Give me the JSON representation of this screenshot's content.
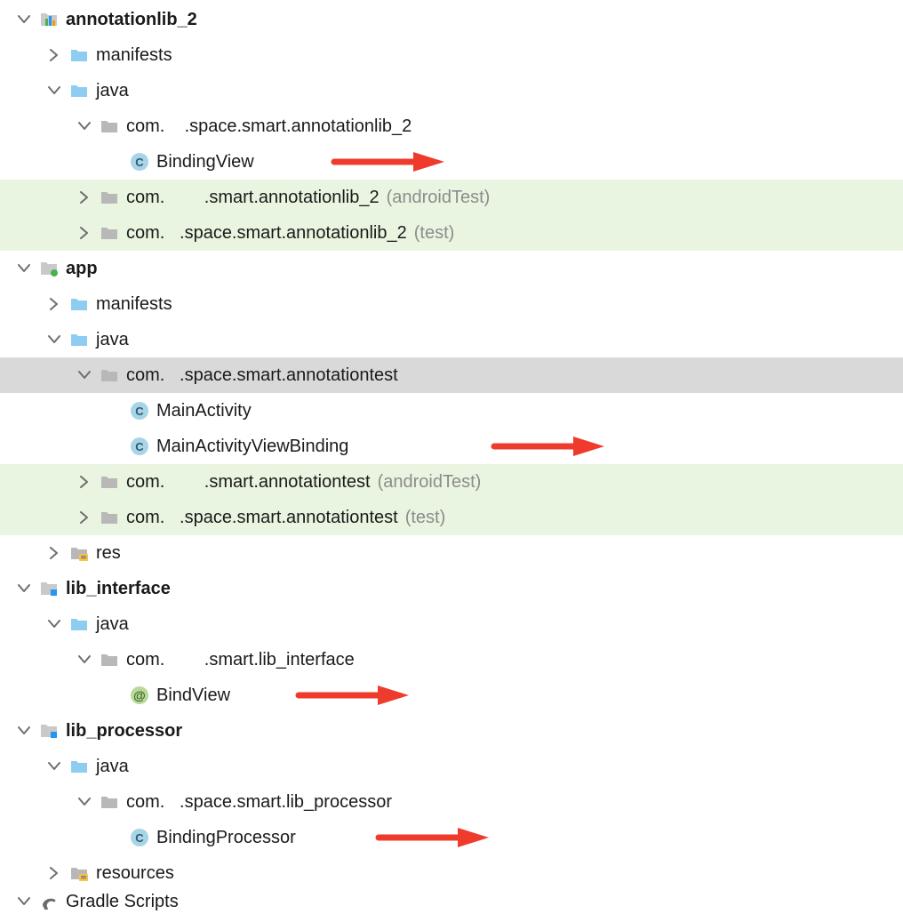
{
  "tree": [
    {
      "id": "r0",
      "depth": 0,
      "chev": "down",
      "iconType": "module-bars",
      "label": "annotationlib_2",
      "bold": true
    },
    {
      "id": "r1",
      "depth": 1,
      "chev": "right",
      "iconType": "folder-blue",
      "label": "manifests"
    },
    {
      "id": "r2",
      "depth": 1,
      "chev": "down",
      "iconType": "folder-blue",
      "label": "java"
    },
    {
      "id": "r3",
      "depth": 2,
      "chev": "down",
      "iconType": "folder-grey",
      "label": "com.    .space.smart.annotationlib_2"
    },
    {
      "id": "r4",
      "depth": 3,
      "chev": "none",
      "iconType": "class-c",
      "label": "BindingView",
      "arrow": true,
      "arrowLeft": 370
    },
    {
      "id": "r5",
      "depth": 2,
      "chev": "right",
      "iconType": "folder-grey",
      "label": "com.        .smart.annotationlib_2",
      "suffix": "(androidTest)",
      "rowClass": "hl-green"
    },
    {
      "id": "r6",
      "depth": 2,
      "chev": "right",
      "iconType": "folder-grey",
      "label": "com.   .space.smart.annotationlib_2",
      "suffix": "(test)",
      "rowClass": "hl-green"
    },
    {
      "id": "r7",
      "depth": 0,
      "chev": "down",
      "iconType": "module-app",
      "label": "app",
      "bold": true
    },
    {
      "id": "r8",
      "depth": 1,
      "chev": "right",
      "iconType": "folder-blue",
      "label": "manifests"
    },
    {
      "id": "r9",
      "depth": 1,
      "chev": "down",
      "iconType": "folder-blue",
      "label": "java"
    },
    {
      "id": "r10",
      "depth": 2,
      "chev": "down",
      "iconType": "folder-grey",
      "label": "com.   .space.smart.annotationtest",
      "rowClass": "hl-grey"
    },
    {
      "id": "r11",
      "depth": 3,
      "chev": "none",
      "iconType": "class-c",
      "label": "MainActivity"
    },
    {
      "id": "r12",
      "depth": 3,
      "chev": "none",
      "iconType": "class-c",
      "label": "MainActivityViewBinding",
      "arrow": true,
      "arrowLeft": 550
    },
    {
      "id": "r13",
      "depth": 2,
      "chev": "right",
      "iconType": "folder-grey",
      "label": "com.        .smart.annotationtest",
      "suffix": "(androidTest)",
      "rowClass": "hl-green"
    },
    {
      "id": "r14",
      "depth": 2,
      "chev": "right",
      "iconType": "folder-grey",
      "label": "com.   .space.smart.annotationtest",
      "suffix": "(test)",
      "rowClass": "hl-green"
    },
    {
      "id": "r15",
      "depth": 1,
      "chev": "right",
      "iconType": "folder-res",
      "label": "res"
    },
    {
      "id": "r16",
      "depth": 0,
      "chev": "down",
      "iconType": "module-lib",
      "label": "lib_interface",
      "bold": true
    },
    {
      "id": "r17",
      "depth": 1,
      "chev": "down",
      "iconType": "folder-blue",
      "label": "java"
    },
    {
      "id": "r18",
      "depth": 2,
      "chev": "down",
      "iconType": "folder-grey",
      "label": "com.        .smart.lib_interface"
    },
    {
      "id": "r19",
      "depth": 3,
      "chev": "none",
      "iconType": "annotation-at",
      "label": "BindView",
      "arrow": true,
      "arrowLeft": 330
    },
    {
      "id": "r20",
      "depth": 0,
      "chev": "down",
      "iconType": "module-lib",
      "label": "lib_processor",
      "bold": true
    },
    {
      "id": "r21",
      "depth": 1,
      "chev": "down",
      "iconType": "folder-blue",
      "label": "java"
    },
    {
      "id": "r22",
      "depth": 2,
      "chev": "down",
      "iconType": "folder-grey",
      "label": "com.   .space.smart.lib_processor"
    },
    {
      "id": "r23",
      "depth": 3,
      "chev": "none",
      "iconType": "class-c",
      "label": "BindingProcessor",
      "arrow": true,
      "arrowLeft": 420
    },
    {
      "id": "r24",
      "depth": 1,
      "chev": "right",
      "iconType": "folder-res",
      "label": "resources"
    },
    {
      "id": "r25",
      "depth": 0,
      "chev": "down-cut",
      "iconType": "gradle",
      "label": "Gradle Scripts",
      "cut": true
    }
  ]
}
